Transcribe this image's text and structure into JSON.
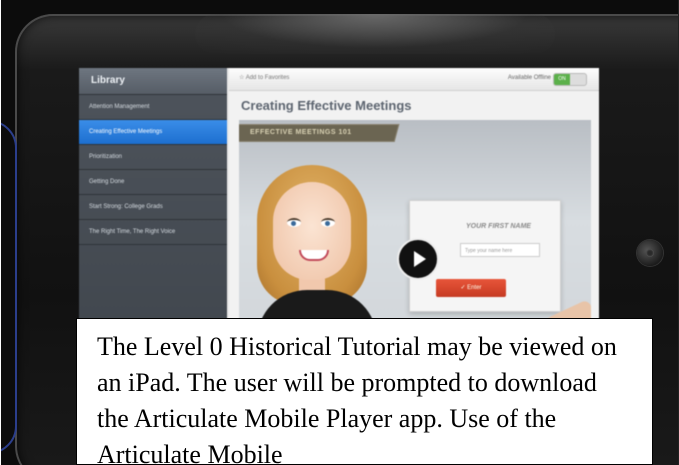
{
  "sidebar": {
    "header": "Library",
    "items": [
      {
        "label": "Attention Management",
        "selected": false
      },
      {
        "label": "Creating Effective Meetings",
        "selected": true
      },
      {
        "label": "Prioritization",
        "selected": false
      },
      {
        "label": "Getting Done",
        "selected": false
      },
      {
        "label": "Start Strong: College Grads",
        "selected": false
      },
      {
        "label": "The Right Time, The Right Voice",
        "selected": false
      }
    ]
  },
  "toolbar": {
    "favorites_label": "☆ Add to Favorites",
    "offline_label": "Available Offline",
    "toggle_label": "ON"
  },
  "course": {
    "title": "Creating Effective Meetings"
  },
  "video": {
    "banner": "EFFECTIVE MEETINGS 101",
    "card_title": "YOUR FIRST NAME",
    "card_field_placeholder": "Type your name here",
    "card_button": "✓ Enter"
  },
  "caption": {
    "text": "The Level 0 Historical Tutorial may be viewed on an iPad.  The user will be prompted to download the Articulate Mobile Player app.  Use of the Articulate Mobile"
  },
  "colors": {
    "selected_item": "#1d6fd0",
    "sidebar_bg": "#3e444b",
    "toggle_on": "#5bb04a",
    "card_button": "#c53a22"
  }
}
